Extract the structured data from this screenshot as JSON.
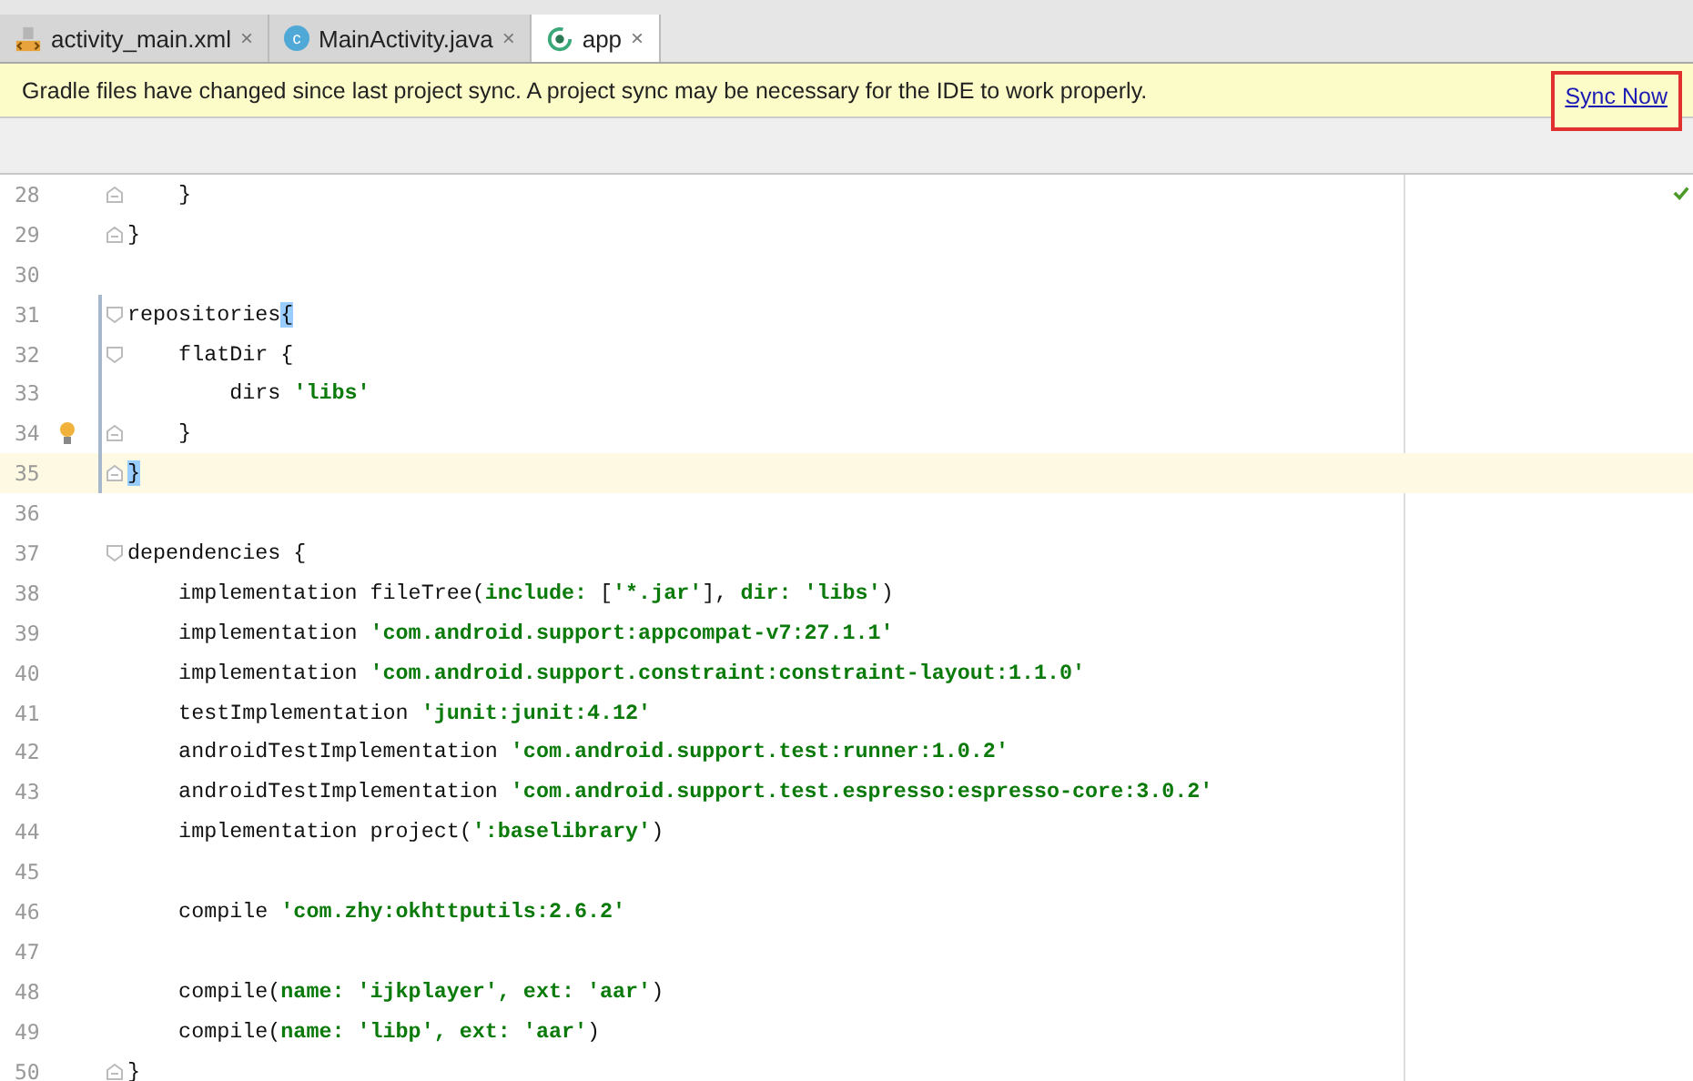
{
  "tabs": [
    {
      "label": "activity_main.xml",
      "kind": "xml",
      "selected": false,
      "close": "×"
    },
    {
      "label": "MainActivity.java",
      "kind": "class",
      "selected": false,
      "close": "×",
      "class_letter": "c"
    },
    {
      "label": "app",
      "kind": "gradle",
      "selected": true,
      "close": "×"
    }
  ],
  "notification": {
    "message": "Gradle files have changed since last project sync. A project sync may be necessary for the IDE to work properly.",
    "action": "Sync Now"
  },
  "editor": {
    "lines": [
      {
        "number": "28",
        "fold_end": true,
        "tokens": [
          {
            "kind": "code",
            "text": "    }"
          }
        ]
      },
      {
        "number": "29",
        "fold_end": true,
        "tokens": [
          {
            "kind": "code",
            "text": "}"
          }
        ]
      },
      {
        "number": "30"
      },
      {
        "number": "31",
        "fold_start": true,
        "scope": true,
        "tokens": [
          {
            "kind": "code",
            "text": "repositories"
          },
          {
            "kind": "brace",
            "text": "{"
          }
        ]
      },
      {
        "number": "32",
        "fold_start": true,
        "scope": true,
        "tokens": [
          {
            "kind": "code",
            "text": "    flatDir {"
          }
        ]
      },
      {
        "number": "33",
        "scope": true,
        "tokens": [
          {
            "kind": "code",
            "text": "        dirs "
          },
          {
            "kind": "literal",
            "text": "'libs'"
          }
        ]
      },
      {
        "number": "34",
        "fold_end": true,
        "scope": true,
        "bulb": true,
        "tokens": [
          {
            "kind": "code",
            "text": "    }"
          }
        ]
      },
      {
        "number": "35",
        "fold_end": true,
        "scope": true,
        "current": true,
        "tokens": [
          {
            "kind": "brace",
            "text": "}"
          }
        ]
      },
      {
        "number": "36"
      },
      {
        "number": "37",
        "fold_start": true,
        "tokens": [
          {
            "kind": "code",
            "text": "dependencies {"
          }
        ]
      },
      {
        "number": "38",
        "tokens": [
          {
            "kind": "code",
            "text": "    implementation fileTree("
          },
          {
            "kind": "literal",
            "text": "include: "
          },
          {
            "kind": "code",
            "text": "["
          },
          {
            "kind": "literal",
            "text": "'*.jar'"
          },
          {
            "kind": "code",
            "text": "], "
          },
          {
            "kind": "literal",
            "text": "dir: 'libs'"
          },
          {
            "kind": "code",
            "text": ")"
          }
        ]
      },
      {
        "number": "39",
        "tokens": [
          {
            "kind": "code",
            "text": "    implementation "
          },
          {
            "kind": "literal",
            "text": "'com.android.support:appcompat-v7:27.1.1'"
          }
        ]
      },
      {
        "number": "40",
        "tokens": [
          {
            "kind": "code",
            "text": "    implementation "
          },
          {
            "kind": "literal",
            "text": "'com.android.support.constraint:constraint-layout:1.1.0'"
          }
        ]
      },
      {
        "number": "41",
        "tokens": [
          {
            "kind": "code",
            "text": "    testImplementation "
          },
          {
            "kind": "literal",
            "text": "'junit:junit:4.12'"
          }
        ]
      },
      {
        "number": "42",
        "tokens": [
          {
            "kind": "code",
            "text": "    androidTestImplementation "
          },
          {
            "kind": "literal",
            "text": "'com.android.support.test:runner:1.0.2'"
          }
        ]
      },
      {
        "number": "43",
        "tokens": [
          {
            "kind": "code",
            "text": "    androidTestImplementation "
          },
          {
            "kind": "literal",
            "text": "'com.android.support.test.espresso:espresso-core:3.0.2'"
          }
        ]
      },
      {
        "number": "44",
        "tokens": [
          {
            "kind": "code",
            "text": "    implementation project("
          },
          {
            "kind": "literal",
            "text": "':baselibrary'"
          },
          {
            "kind": "code",
            "text": ")"
          }
        ]
      },
      {
        "number": "45"
      },
      {
        "number": "46",
        "tokens": [
          {
            "kind": "code",
            "text": "    compile "
          },
          {
            "kind": "literal",
            "text": "'com.zhy:okhttputils:2.6.2'"
          }
        ]
      },
      {
        "number": "47"
      },
      {
        "number": "48",
        "tokens": [
          {
            "kind": "code",
            "text": "    compile("
          },
          {
            "kind": "literal",
            "text": "name: 'ijkplayer', ext: 'aar'"
          },
          {
            "kind": "code",
            "text": ")"
          }
        ]
      },
      {
        "number": "49",
        "tokens": [
          {
            "kind": "code",
            "text": "    compile("
          },
          {
            "kind": "literal",
            "text": "name: 'libp', ext: 'aar'"
          },
          {
            "kind": "code",
            "text": ")"
          }
        ]
      },
      {
        "number": "50",
        "fold_end": true,
        "tokens": [
          {
            "kind": "code",
            "text": "}"
          }
        ]
      }
    ]
  }
}
